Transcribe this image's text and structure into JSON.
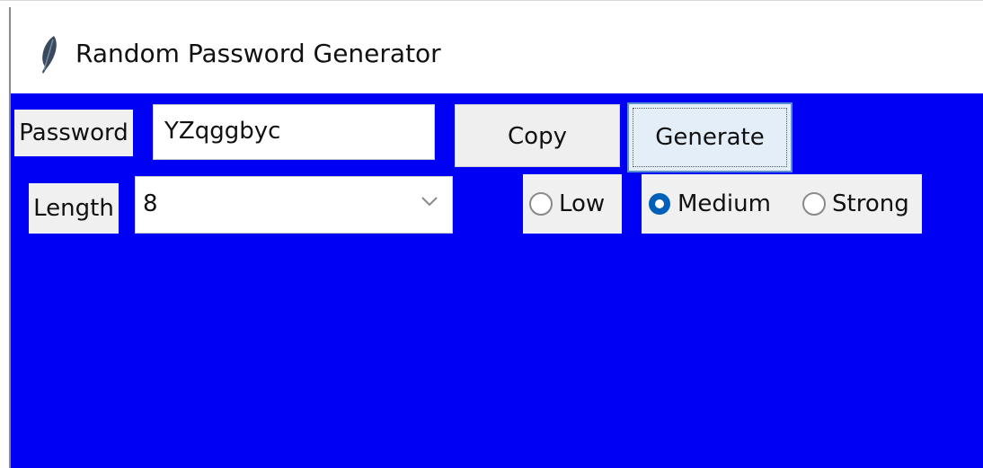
{
  "window": {
    "title": "Random Password Generator",
    "app_icon": "feather-icon"
  },
  "password_row": {
    "label": "Password",
    "value": "YZqggbyc",
    "copy_label": "Copy",
    "generate_label": "Generate"
  },
  "length_row": {
    "label": "Length",
    "selected": "8",
    "dropdown_icon": "chevron-down-icon"
  },
  "strength": {
    "options": [
      {
        "label": "Low",
        "checked": false
      },
      {
        "label": "Medium",
        "checked": true
      },
      {
        "label": "Strong",
        "checked": false
      }
    ]
  },
  "colors": {
    "background": "#0000f5",
    "radio_accent": "#005fb8"
  }
}
